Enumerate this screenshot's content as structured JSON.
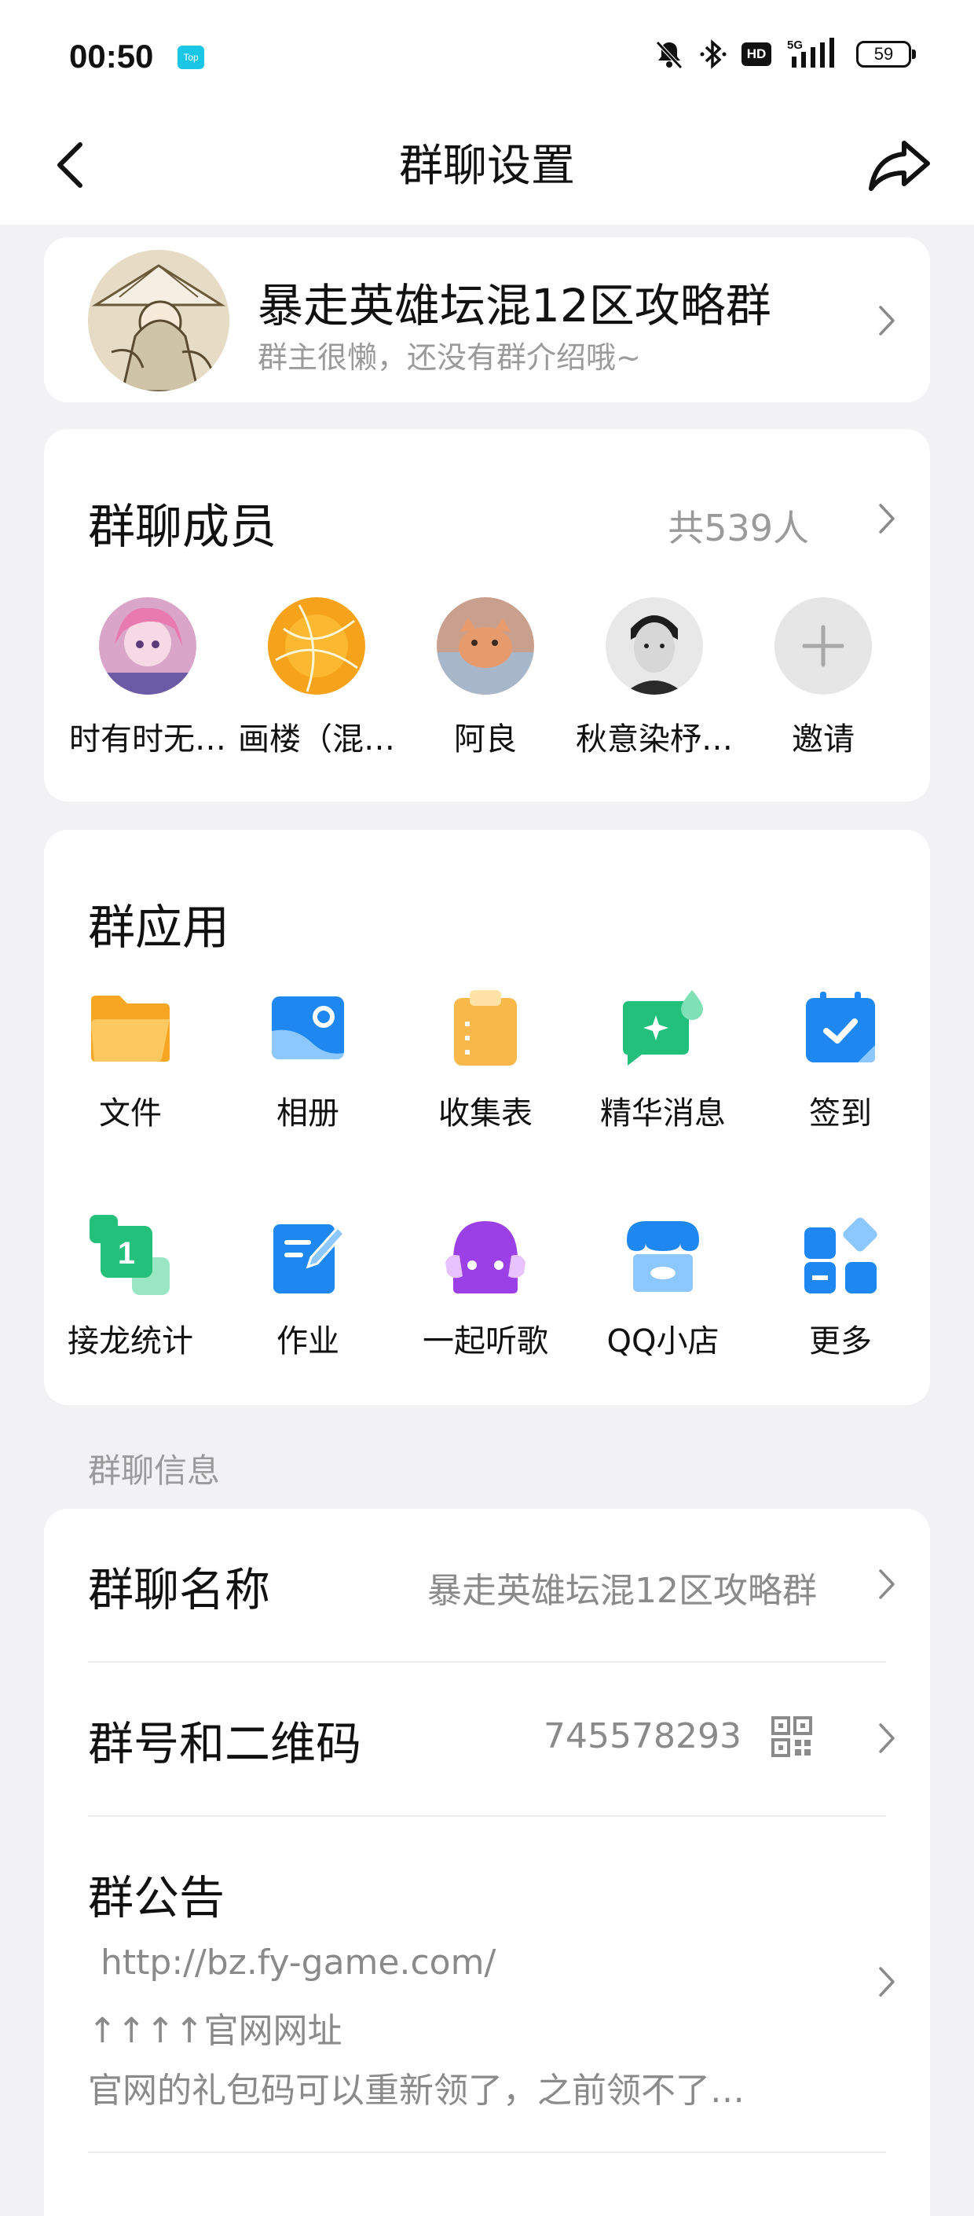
{
  "status_bar": {
    "time": "00:50",
    "app_badge": "Top",
    "network": "5G",
    "hd_label": "HD",
    "battery": "59"
  },
  "nav": {
    "title": "群聊设置"
  },
  "group": {
    "name": "暴走英雄坛混12区攻略群",
    "description": "群主很懒，还没有群介绍哦~"
  },
  "members": {
    "title": "群聊成员",
    "count_label": "共539人",
    "items": [
      {
        "name": "时有时无…"
      },
      {
        "name": "画楼（混…"
      },
      {
        "name": "阿良"
      },
      {
        "name": "秋意染杼…"
      },
      {
        "name": "邀请"
      }
    ]
  },
  "apps": {
    "title": "群应用",
    "items": [
      {
        "label": "文件",
        "icon": "folder-icon"
      },
      {
        "label": "相册",
        "icon": "album-icon"
      },
      {
        "label": "收集表",
        "icon": "clipboard-icon"
      },
      {
        "label": "精华消息",
        "icon": "essence-message-icon"
      },
      {
        "label": "签到",
        "icon": "calendar-check-icon"
      },
      {
        "label": "接龙统计",
        "icon": "relay-icon"
      },
      {
        "label": "作业",
        "icon": "homework-icon"
      },
      {
        "label": "一起听歌",
        "icon": "headphones-icon"
      },
      {
        "label": "QQ小店",
        "icon": "shop-icon"
      },
      {
        "label": "更多",
        "icon": "more-apps-icon"
      }
    ]
  },
  "info": {
    "section_label": "群聊信息",
    "name_row": {
      "label": "群聊名称",
      "value": "暴走英雄坛混12区攻略群"
    },
    "number_row": {
      "label": "群号和二维码",
      "value": "745578293"
    },
    "notice": {
      "label": "群公告",
      "lines": [
        "http://bz.fy-game.com/",
        "↑↑↑↑官网网址",
        "官网的礼包码可以重新领了，之前领不了…"
      ]
    }
  },
  "colors": {
    "background": "#f2f2f5",
    "card": "#ffffff",
    "secondary_text": "#9a9a9a",
    "accent_blue": "#1e88f0"
  }
}
